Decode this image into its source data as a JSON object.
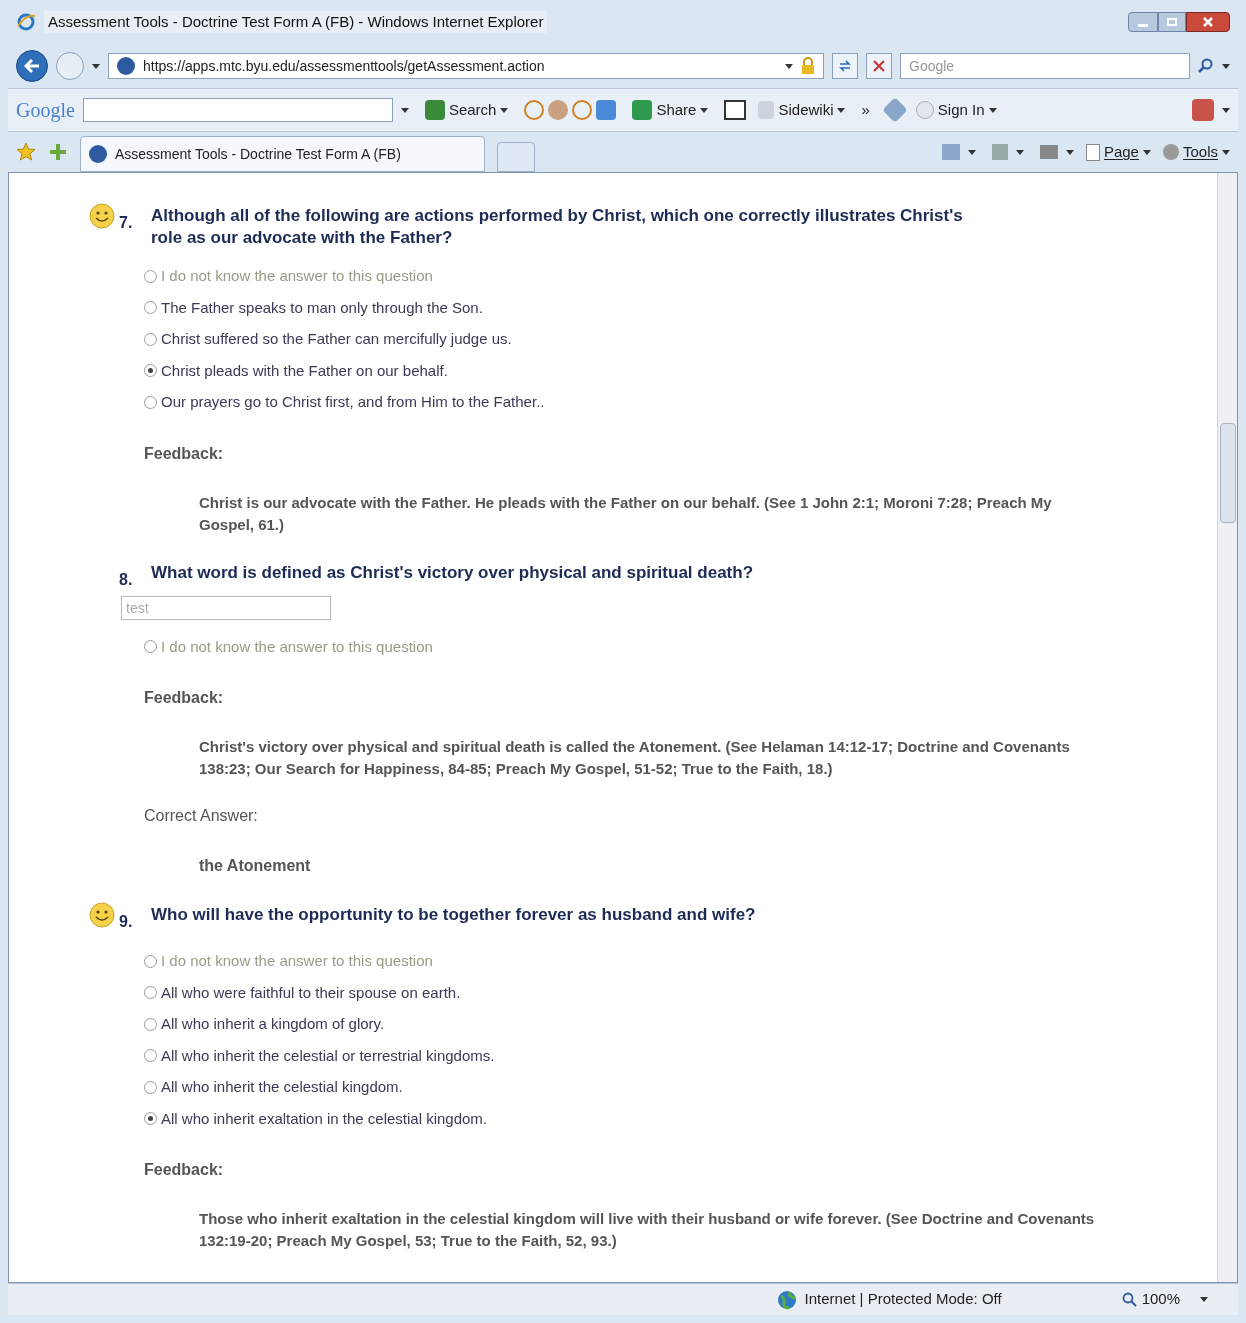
{
  "window": {
    "title": "Assessment Tools - Doctrine Test Form A (FB) - Windows Internet Explorer"
  },
  "address_bar": {
    "url": "https://apps.mtc.byu.edu/assessmenttools/getAssessment.action",
    "search_placeholder": "Google"
  },
  "google_toolbar": {
    "logo": "Google",
    "items": [
      {
        "label": "Search"
      },
      {
        "label": "Share"
      },
      {
        "label": "Sidewiki"
      },
      {
        "label": "»"
      },
      {
        "label": "Sign In"
      }
    ]
  },
  "tab": {
    "title": "Assessment Tools - Doctrine Test Form A (FB)"
  },
  "command_bar": [
    "Page",
    "Tools"
  ],
  "questions": [
    {
      "number": "7.",
      "smiley": true,
      "text": "Although all of the following are actions performed by Christ, which one correctly illustrates Christ's role as our advocate with the Father?",
      "options": [
        {
          "label": "I do not know the answer to this question",
          "kind": "skip",
          "selected": false
        },
        {
          "label": "The Father speaks to man only through the Son.",
          "kind": "answer",
          "selected": false
        },
        {
          "label": "Christ suffered so the Father can mercifully judge us.",
          "kind": "answer",
          "selected": false
        },
        {
          "label": "Christ pleads with the Father on our behalf.",
          "kind": "answer",
          "selected": true
        },
        {
          "label": "Our prayers go to Christ first, and from Him to the Father..",
          "kind": "answer",
          "selected": false
        }
      ],
      "feedback_label": "Feedback:",
      "feedback": "Christ is our advocate with the Father. He pleads with the Father on our behalf. (See 1 John 2:1; Moroni 7:28; Preach My Gospel, 61.)"
    },
    {
      "number": "8.",
      "smiley": false,
      "text": "What word is defined as Christ's victory over physical and spiritual death?",
      "answer_field": {
        "value": "test"
      },
      "options": [
        {
          "label": "I do not know the answer to this question",
          "kind": "skip",
          "selected": false
        }
      ],
      "feedback_label": "Feedback:",
      "feedback": "Christ's victory over physical and spiritual death is called the Atonement. (See Helaman 14:12-17; Doctrine and Covenants 138:23; Our Search for Happiness, 84-85; Preach My Gospel, 51-52; True to the Faith, 18.)",
      "correct_label": "Correct Answer:",
      "correct_answer": "the Atonement"
    },
    {
      "number": "9.",
      "smiley": true,
      "text": "Who will have the opportunity to be together forever as husband and wife?",
      "options": [
        {
          "label": "I do not know the answer to this question",
          "kind": "skip",
          "selected": false
        },
        {
          "label": "All who were faithful to their spouse on earth.",
          "kind": "answer",
          "selected": false
        },
        {
          "label": "All who inherit a kingdom of glory.",
          "kind": "answer",
          "selected": false
        },
        {
          "label": "All who inherit the celestial or terrestrial kingdoms.",
          "kind": "answer",
          "selected": false
        },
        {
          "label": "All who inherit the celestial kingdom.",
          "kind": "answer",
          "selected": false
        },
        {
          "label": "All who inherit exaltation in the celestial kingdom.",
          "kind": "answer",
          "selected": true
        }
      ],
      "feedback_label": "Feedback:",
      "feedback": "Those who inherit exaltation in the celestial kingdom will live with their husband or wife forever. (See Doctrine and Covenants 132:19-20; Preach My Gospel, 53; True to the Faith, 52, 93.)"
    }
  ],
  "status_bar": {
    "zone": "Internet | Protected Mode: Off",
    "zoom": "100%"
  }
}
